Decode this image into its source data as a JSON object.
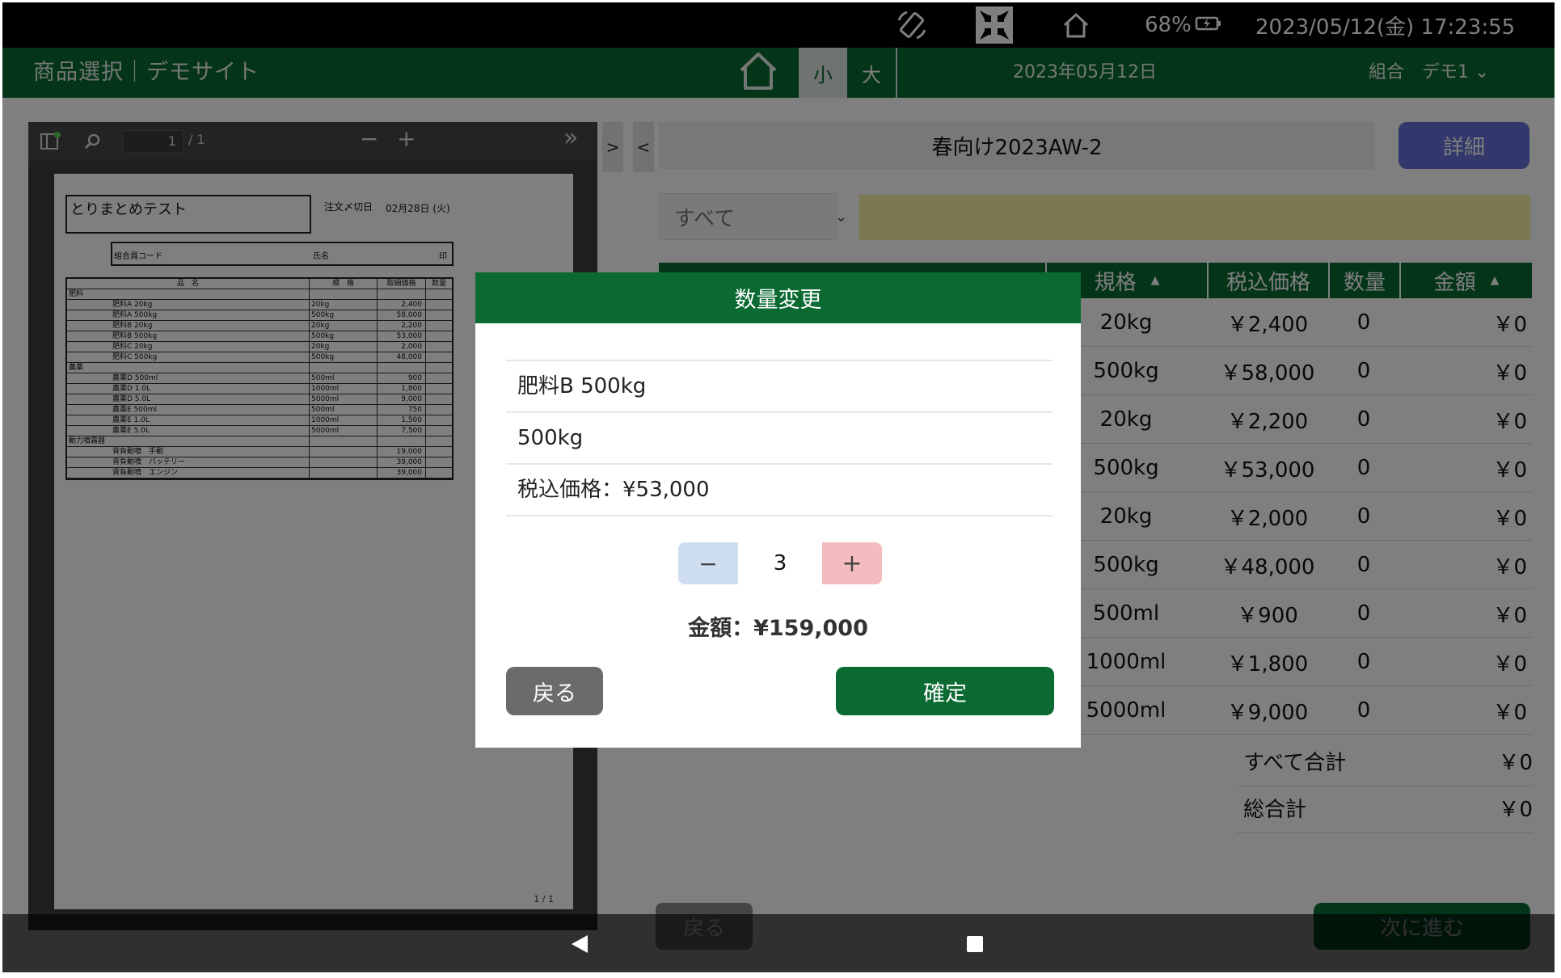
{
  "statusbar": {
    "battery": "68%",
    "datetime": "2023/05/12(金) 17:23:55",
    "icons": [
      "rotate-icon",
      "exit-fullscreen-icon",
      "home-icon",
      "battery-charging-icon"
    ]
  },
  "header": {
    "title": "商品選択｜デモサイト",
    "size_small": "小",
    "size_large": "大",
    "date": "2023年05月12日",
    "user": "組合　デモ1 ⌄"
  },
  "pdf": {
    "page_input": "1",
    "page_total": "/ 1",
    "zoom_out": "−",
    "zoom_in": "+",
    "more": "»",
    "footer": "1 / 1",
    "doc": {
      "title": "とりまとめテスト",
      "deadline_label": "注文〆切日",
      "deadline_value": "02月28日 (火)",
      "member_code_label": "組合員コード",
      "name_label": "氏名",
      "seal_label": "印",
      "columns": [
        "品　名",
        "規　格",
        "取細価格",
        "数量"
      ],
      "rows": [
        [
          "肥料",
          "",
          "",
          "",
          true
        ],
        [
          "肥料A 20kg",
          "20kg",
          "2,400",
          ""
        ],
        [
          "肥料A 500kg",
          "500kg",
          "58,000",
          ""
        ],
        [
          "肥料B 20kg",
          "20kg",
          "2,200",
          ""
        ],
        [
          "肥料B 500kg",
          "500kg",
          "53,000",
          ""
        ],
        [
          "肥料C 20kg",
          "20kg",
          "2,000",
          ""
        ],
        [
          "肥料C 500kg",
          "500kg",
          "48,000",
          ""
        ],
        [
          "農薬",
          "",
          "",
          "",
          true
        ],
        [
          "農薬D 500ml",
          "500ml",
          "900",
          ""
        ],
        [
          "農薬D 1.0L",
          "1000ml",
          "1,800",
          ""
        ],
        [
          "農薬D 5.0L",
          "5000ml",
          "9,000",
          ""
        ],
        [
          "農薬E 500ml",
          "500ml",
          "750",
          ""
        ],
        [
          "農薬E 1.0L",
          "1000ml",
          "1,500",
          ""
        ],
        [
          "農薬E 5.0L",
          "5000ml",
          "7,500",
          ""
        ],
        [
          "動力噴霧器",
          "",
          "",
          "",
          true
        ],
        [
          "背負動噴　手動",
          "",
          "19,000",
          ""
        ],
        [
          "背負動噴　バッテリー",
          "",
          "39,000",
          ""
        ],
        [
          "背負動噴　エンジン",
          "",
          "39,000",
          ""
        ]
      ]
    }
  },
  "panel": {
    "toggle_right": ">",
    "toggle_left": "<",
    "catalog_title": "春向け2023AW-2",
    "detail_button": "詳細",
    "filter_value": "すべて",
    "filter_chevron": "⌄",
    "table": {
      "headers": [
        "規格",
        "税込価格",
        "数量",
        "金額"
      ],
      "rows": [
        [
          "20kg",
          "￥2,400",
          "0",
          "￥0"
        ],
        [
          "500kg",
          "￥58,000",
          "0",
          "￥0"
        ],
        [
          "20kg",
          "￥2,200",
          "0",
          "￥0"
        ],
        [
          "500kg",
          "￥53,000",
          "0",
          "￥0"
        ],
        [
          "20kg",
          "￥2,000",
          "0",
          "￥0"
        ],
        [
          "500kg",
          "￥48,000",
          "0",
          "￥0"
        ],
        [
          "500ml",
          "￥900",
          "0",
          "￥0"
        ],
        [
          "1000ml",
          "￥1,800",
          "0",
          "￥0"
        ],
        [
          "5000ml",
          "￥9,000",
          "0",
          "￥0"
        ]
      ]
    },
    "totals": [
      {
        "label": "すべて合計",
        "value": "￥0"
      },
      {
        "label": "総合計",
        "value": "￥0"
      }
    ],
    "back_button": "戻る",
    "next_button": "次に進む"
  },
  "dialog": {
    "title": "数量変更",
    "product_name": "肥料B 500kg",
    "spec": "500kg",
    "price": "税込価格：¥53,000",
    "minus": "−",
    "quantity": "3",
    "plus": "+",
    "amount": "金額：¥159,000",
    "back_button": "戻る",
    "confirm_button": "確定"
  },
  "colors": {
    "header_green": "#0a6a32",
    "detail_button": "#6570d8",
    "filter_bar": "#f5f3a8",
    "stepper_minus": "#cfddf1",
    "stepper_plus": "#f5bcbf"
  }
}
